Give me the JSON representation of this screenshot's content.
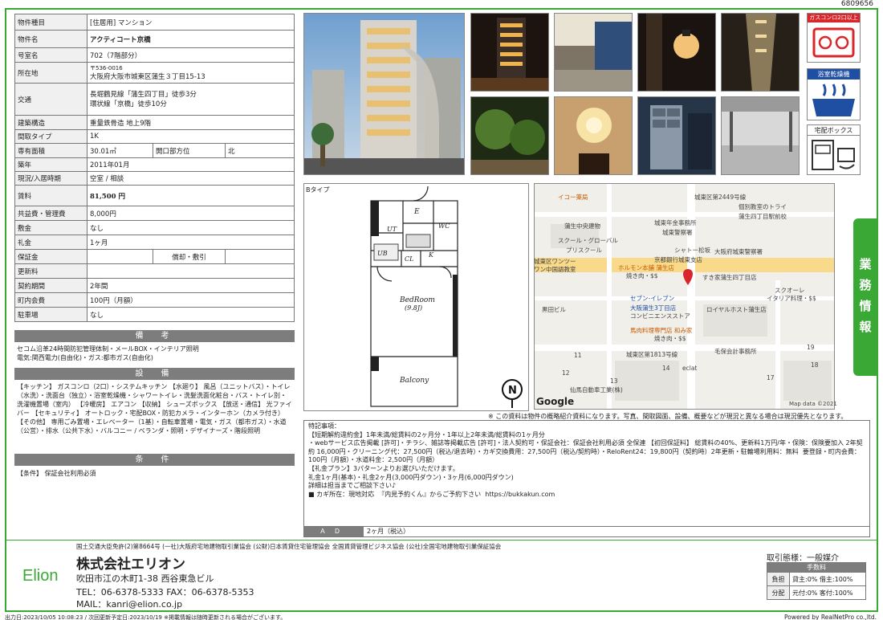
{
  "sheet_id": "6809656",
  "property": {
    "type_label": "物件種目",
    "type_value": "[住居用] マンション",
    "name_label": "物件名",
    "name_value": "アクティコート京橋",
    "room_label": "号室名",
    "room_value": "702（7階部分）",
    "address_label": "所在地",
    "postal": "〒536-0016",
    "address_value": "大阪府大阪市城東区蒲生３丁目15-13",
    "access_label": "交通",
    "access_line1": "長堀鶴見線「蒲生四丁目」徒歩3分",
    "access_line2": "環状線「京橋」徒歩10分",
    "structure_label": "建築構造",
    "structure_value": "重量鉄骨造 地上9階",
    "layout_label": "間取タイプ",
    "layout_value": "1K",
    "area_label": "専有面積",
    "area_value": "30.01㎡",
    "direction_label": "開口部方位",
    "direction_value": "北",
    "built_label": "築年",
    "built_value": "2011年01月",
    "status_label": "現況/入居時期",
    "status_value": "空室 / 相談",
    "rent_label": "賃料",
    "rent_value": "81,500 円",
    "fee_label": "共益費・管理費",
    "fee_value": "8,000円",
    "deposit_label": "敷金",
    "deposit_value": "なし",
    "key_money_label": "礼金",
    "key_money_value": "1ヶ月",
    "security_label": "保証金",
    "security_value": "",
    "amortization_label": "償却・敷引",
    "amortization_value": "",
    "renewal_label": "更新料",
    "renewal_value": "",
    "contract_label": "契約期間",
    "contract_value": "2年間",
    "community_label": "町内会費",
    "community_value": "100円（月額）",
    "parking_label": "駐車場",
    "parking_value": "なし"
  },
  "remarks": {
    "title": "備　考",
    "line1": "セコム沿革24時間防犯管理体制・メールBOX・インテリア照明",
    "line2": "電気:関西電力(自由化)・ガス:都市ガス(自由化)"
  },
  "equipment": {
    "title": "設　備",
    "text": "【キッチン】 ガスコンロ（2口）・システムキッチン 【水廻り】 風呂（ユニットバス）・トイレ（水洗）・洗面台（独立）・浴室乾燥機・シャワートイレ・洗髪洗面化粧台・バス・トイレ別・洗濯機置場（室内） 【冷暖房】 エアコン 【収納】 シューズボックス 【放送・通信】 光ファイバー 【セキュリティ】 オートロック・宅配BOX・防犯カメラ・インターホン（カメラ付き） 【その他】 専用ごみ置場・エレベーター（1基）・自転車置場・電気・ガス（都市ガス）・水道（公営）・排水（公共下水）・バルコニー / ベランダ・照明・デザイナーズ・階段照明"
  },
  "conditions": {
    "title": "条　件",
    "text": "【条件】 保証会社利用必須"
  },
  "floorplan": {
    "label": "Bタイプ",
    "room_e": "E",
    "room_wc": "WC",
    "room_ut": "UT",
    "room_ub": "UB",
    "room_cl": "CL",
    "room_k": "K",
    "bedroom": "BedRoom",
    "bedroom_size": "(9.8J)",
    "balcony": "Balcony",
    "north": "N"
  },
  "map": {
    "labels": [
      "イコー薬局",
      "城東区第2449号線",
      "個別教室のトライ",
      "蒲生四丁目駅前校",
      "蒲生中央建物",
      "城東年金事務所",
      "城東警察署",
      "スクール・グローバル",
      "プリスクール",
      "シャトー松坂",
      "京都銀行城東支店",
      "大阪府城東警察署",
      "城東区ワンツー",
      "ワン中国語教室",
      "ホルモン本舗 蒲生店",
      "焼き肉・$$",
      "すき家蒲生四丁目店",
      "スクオーレ",
      "イタリア料理・$$",
      "セブン-イレブン",
      "大阪蒲生3丁目店",
      "コンビニエンスストア",
      "ロイヤルホスト蒲生店",
      "黒田ビル",
      "馬肉料理専門店 和み家",
      "焼き肉・$$",
      "城東区第1813号線",
      "毛保会計事務所",
      "eclat",
      "仙馬自動車工業(株)",
      "12",
      "13",
      "14",
      "19",
      "18",
      "11",
      "17"
    ],
    "google": "Google",
    "copyright": "Map data ©2021"
  },
  "disclaimer": "※ この資料は物件の概略紹介資料になります。写真、間取図面、設備、概要などが現況と異なる場合は現況優先となります。",
  "notes": {
    "title": "特記事項：",
    "body": "【短期解約違約金】1年未満/総賃料の2ヶ月分・1年以上2年未満/総賃料の1ヶ月分\n・webサービス広告掲載 [許可]・チラシ、雑誌等掲載広告 [許可]・法人契約可・保証会社：保証会社利用必須 全保連 【初回保証料】 総賃料の40%、更新料1万円/年・保険：保険要加入 2年契約 16,000円・クリーニング代：27,500円（税込/退去時）・カギ交換費用：27,500円（税込/契約時）・ReloRent24：19,800円（契約時）2年更新・駐輪場利用料：無料  要登録・町内会費：100円（月額）・水道料金：2,500円（月額）\n【礼金プラン】3パターンよりお選びいただけます。\n礼金1ヶ月(基本)・礼金2ヶ月(3,000円ダウン)・3ヶ月(6,000円ダウン)\n詳細は担当までご相談下さい♪\n■ カギ所在：現地対応  『内見予約くん』からご予約下さい  https://bukkakun.com"
  },
  "ad": {
    "label": "ＡＤ",
    "value": "2ヶ月（税込）"
  },
  "badges": {
    "gas": "ガスコンロ2口以上",
    "bath": "浴室乾燥機",
    "delivery": "宅配ボックス"
  },
  "side_tab": {
    "line1": "業",
    "line2": "務",
    "line3": "情",
    "line4": "報"
  },
  "company": {
    "registration": "国土交通大臣免許(2)第8664号 (一社)大阪府宅地建物取引業協会 (公財)日本賃貸住宅管理協会 全国賃貸管理ビジネス協会 (公社)全国宅地建物取引業保証協会",
    "name": "株式会社エリオン",
    "logo": "Elion",
    "address": "吹田市江の木町1-38 西谷東急ビル",
    "tel": "TEL：06-6378-5333  FAX：06-6378-5353",
    "mail": "MAIL：kanri@elion.co.jp"
  },
  "deal": {
    "mode": "取引態様：一般媒介",
    "fee_title": "手数料",
    "burden_label": "負担",
    "burden_value": "貸主:0% 借主:100%",
    "split_label": "分配",
    "split_value": "元付:0% 客付:100%"
  },
  "footer": {
    "left": "出力日:2023/10/05 10:08:23 / 次回更新予定日:2023/10/19 ※掲載情報は随時更新される場合がございます。",
    "right": "Powered by RealNetPro co.,ltd."
  },
  "colors": {
    "brand": "#3aa835",
    "header_gray": "#7d7d7d",
    "badge_red": "#d9262b",
    "badge_blue": "#1f4fa3",
    "map_pin": "#d9262b"
  }
}
